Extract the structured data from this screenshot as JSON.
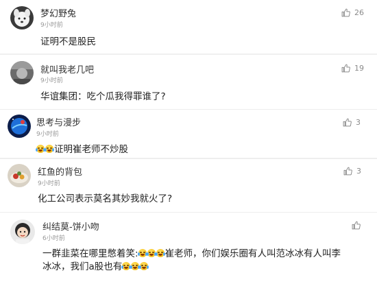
{
  "comments": [
    {
      "username": "梦幻野兔",
      "time": "9小时前",
      "likes": "26",
      "text": "证明不是股民",
      "avatar_icon": "avatar-white-dog-icon"
    },
    {
      "username": "就叫我老几吧",
      "time": "9小时前",
      "likes": "19",
      "text": "华谊集团：吃个瓜我得罪谁了?",
      "avatar_icon": "avatar-gray-face-icon"
    },
    {
      "username": "思考与漫步",
      "time": "9小时前",
      "likes": "3",
      "text": "证明崔老师不炒股",
      "avatar_icon": "avatar-blue-planet-icon"
    },
    {
      "username": "红鱼的背包",
      "time": "9小时前",
      "likes": "3",
      "text": "化工公司表示莫名其妙我就火了?",
      "avatar_icon": "avatar-food-icon"
    },
    {
      "username": "纠结莫-饼小吻",
      "time": "6小时前",
      "likes": "",
      "text_line1_a": "一群韭菜在哪里憋着笑:",
      "text_line1_b": "崔老师，你们娱乐圈有人叫范冰冰有人叫李",
      "text_line2": "冰冰，我们a股也有",
      "avatar_icon": "avatar-girl-icon"
    }
  ],
  "colors": {
    "name": "#333333",
    "time": "#999999",
    "text": "#222222",
    "like": "#8a8a8a"
  },
  "icons": {
    "like": "thumbs-up-icon",
    "laugh_cry": "laugh-cry-emoji-icon"
  }
}
